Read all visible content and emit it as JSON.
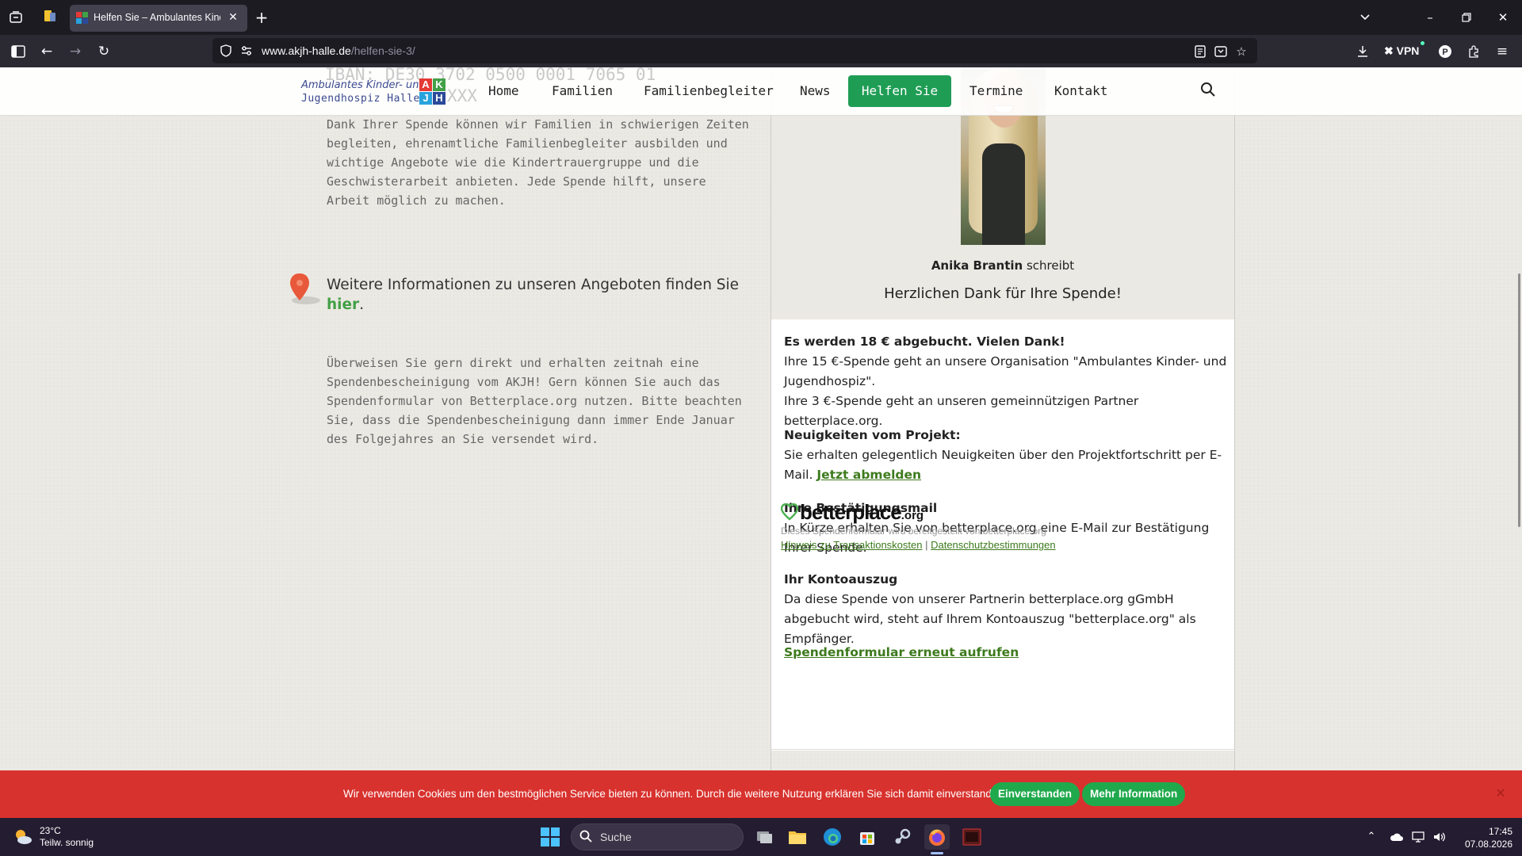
{
  "browser": {
    "active_tab_title": "Helfen Sie – Ambulantes Kinder",
    "url_host": "www.akjh-halle.de",
    "url_path": "/helfen-sie-3/",
    "vpn_label": "VPN"
  },
  "site": {
    "logo_line1": "Ambulantes Kinder- und",
    "logo_line2": "Jugendhospiz Halle",
    "logo_letters": [
      "A",
      "K",
      "J",
      "H"
    ],
    "logo_colors": [
      "#e53935",
      "#43a047",
      "#29a3dd",
      "#2c4a9a"
    ],
    "ghost_line1": "IBAN: DE30 3702 0500 0001 7065 01",
    "ghost_line2": "XXX",
    "menu": [
      "Home",
      "Familien",
      "Familienbegleiter",
      "News",
      "Helfen Sie",
      "Termine",
      "Kontakt"
    ],
    "active_menu_color": "#1f9d55"
  },
  "content": {
    "donation_text": "Dank Ihrer Spende können wir Familien in schwierigen Zeiten begleiten, ehrenamtliche Familienbegleiter ausbilden und wichtige Angebote wie die Kindertrauergruppe und die Geschwisterarbeit anbieten. Jede Spende hilft, unsere Arbeit möglich zu machen.",
    "info_heading_pre": "Weitere Informationen zu unseren Angeboten finden Sie ",
    "info_heading_link": "hier",
    "info_heading_post": ".",
    "transfer_text": "Überweisen Sie gern direkt und erhalten zeitnah eine Spendenbescheinigung vom AKJH! Gern können Sie auch das Spendenformular von Betterplace.org nutzen. Bitte beachten Sie, dass die Spendenbescheinigung dann immer Ende Januar des Folgejahres an Sie versendet wird."
  },
  "widget": {
    "author_name": "Anika Brantin",
    "author_suffix": " schreibt",
    "thanks": "Herzlichen Dank für Ihre Spende!",
    "booked_title": "Es werden 18 € abgebucht. Vielen Dank!",
    "booked_line1": "Ihre 15 €-Spende geht an unsere Organisation \"Ambulantes Kinder- und Jugendhospiz\".",
    "booked_line2": "Ihre 3 €-Spende geht an unseren gemeinnützigen Partner betterplace.org.",
    "news_title": "Neuigkeiten vom Projekt:",
    "news_text": "Sie erhalten gelegentlich Neuigkeiten über den Projektfortschritt per E-Mail. ",
    "unsubscribe": "Jetzt abmelden",
    "confirm_title": "Ihre Bestätigungsmail",
    "confirm_text": "In Kürze erhalten Sie von betterplace.org eine E-Mail zur Bestätigung Ihrer Spende.",
    "statement_title": "Ihr Kontoauszug",
    "statement_text": "Da diese Spende von unserer Partnerin betterplace.org gGmbH abgebucht wird, steht auf Ihrem Kontoauszug \"betterplace.org\" als Empfänger.",
    "reopen": "Spendenformular erneut aufrufen",
    "bp_logo": "betterplace",
    "bp_org": ".org",
    "bp_note": "Dieses Spendenformular wird bereitgestellt von betterplace.org",
    "bp_link1": "Hinweis zu Transaktionskosten",
    "bp_sep": " | ",
    "bp_link2": "Datenschutzbestimmungen"
  },
  "cookie": {
    "text": "Wir verwenden Cookies um den bestmöglichen Service bieten zu können. Durch die weitere Nutzung erklären Sie sich damit einverstanden.",
    "accept": "Einverstanden",
    "more": "Mehr Information"
  },
  "taskbar": {
    "temp": "23°C",
    "weather": "Teilw. sonnig",
    "search_placeholder": "Suche",
    "time": "17:45",
    "date": "07.08.2026"
  }
}
